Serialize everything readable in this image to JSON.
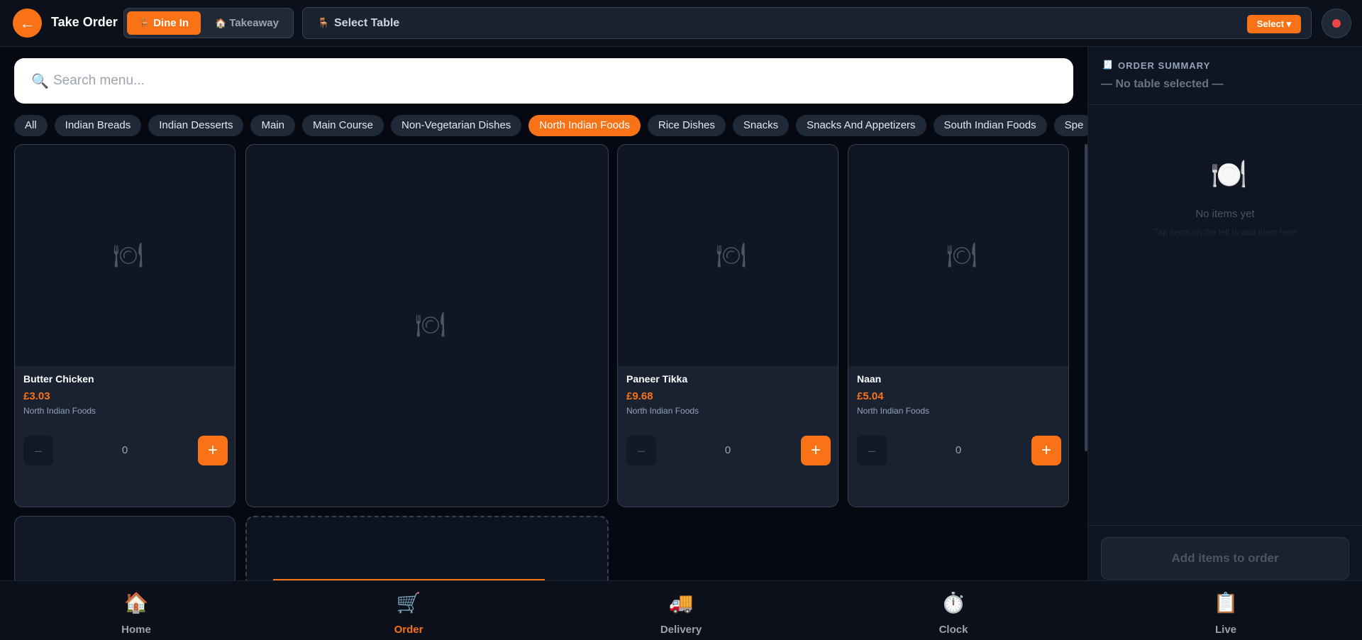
{
  "header": {
    "back_icon": "←",
    "title": "Take Order",
    "order_types": [
      {
        "label": "Dine In",
        "icon": "🪑",
        "active": true
      },
      {
        "label": "Takeaway",
        "icon": "🏠",
        "active": false
      }
    ],
    "table_select": {
      "icon": "🪑",
      "label": "Select Table",
      "button": "Select ▾"
    }
  },
  "search": {
    "icon": "🔍",
    "placeholder": "Search menu..."
  },
  "categories": [
    {
      "label": "All"
    },
    {
      "label": "Indian Breads"
    },
    {
      "label": "Indian Desserts"
    },
    {
      "label": "Main"
    },
    {
      "label": "Main Course"
    },
    {
      "label": "Non-Vegetarian Dishes"
    },
    {
      "label": "North Indian Foods",
      "active": true
    },
    {
      "label": "Rice Dishes"
    },
    {
      "label": "Snacks"
    },
    {
      "label": "Snacks And Appetizers"
    },
    {
      "label": "South Indian Foods"
    },
    {
      "label": "Spe"
    }
  ],
  "menu_items": [
    {
      "name": "Butter Chicken",
      "price": "£3.03",
      "category": "North Indian Foods",
      "qty": "0"
    },
    {
      "name": "Paneer Tikka",
      "price": "£9.68",
      "category": "North Indian Foods",
      "qty": "0"
    },
    {
      "name": "Naan",
      "price": "£5.04",
      "category": "North Indian Foods",
      "qty": "0"
    }
  ],
  "icons": {
    "plate": "🍽",
    "minus": "–",
    "plus": "+"
  },
  "order_summary": {
    "icon": "🧾",
    "title": "ORDER SUMMARY",
    "table_status": "— No table selected —",
    "empty_icon": "🍽️",
    "empty_title": "No items yet",
    "empty_hint": "Tap items on the left to add them here",
    "submit_label": "Add items to order"
  },
  "nav": [
    {
      "label": "Home",
      "icon": "🏠"
    },
    {
      "label": "Order",
      "icon": "🛒",
      "active": true
    },
    {
      "label": "Delivery",
      "icon": "🚚"
    },
    {
      "label": "Clock",
      "icon": "⏱️"
    },
    {
      "label": "Live",
      "icon": "📋"
    }
  ],
  "colors": {
    "accent": "#f97316",
    "background": "#060912",
    "panel": "#111827"
  }
}
